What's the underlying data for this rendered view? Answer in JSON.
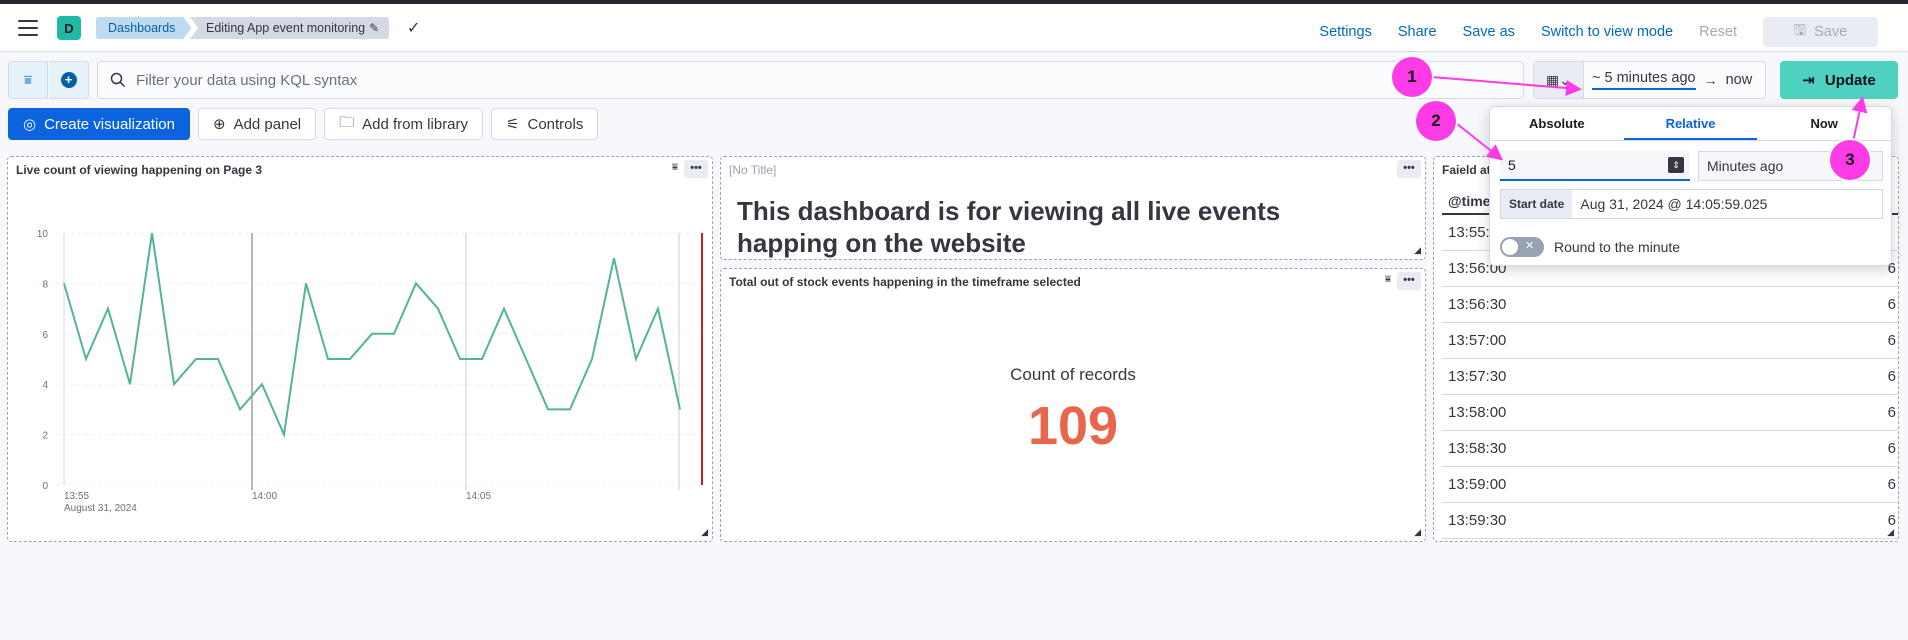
{
  "header": {
    "app_initial": "D",
    "breadcrumbs": [
      "Dashboards",
      "Editing App event monitoring"
    ],
    "links": [
      "Settings",
      "Share",
      "Save as",
      "Switch to view mode",
      "Reset"
    ],
    "save_label": "Save"
  },
  "querybar": {
    "kql_placeholder": "Filter your data using KQL syntax",
    "start": "~ 5 minutes ago",
    "end": "now",
    "update_label": "Update"
  },
  "toolbar": {
    "create_visualization": "Create visualization",
    "add_panel": "Add panel",
    "add_from_library": "Add from library",
    "controls": "Controls"
  },
  "panels": {
    "line_title": "Live count of viewing happening on Page 3",
    "note_title": "[No Title]",
    "note_text": "This dashboard is for viewing all live events happing on the website",
    "metric_title": "Total out of stock events happening in the timeframe selected",
    "metric_label": "Count of records",
    "metric_value": "109",
    "table_title": "Faield at",
    "table_header": "@time"
  },
  "table_rows": [
    {
      "time": "13:55:",
      "value": ""
    },
    {
      "time": "13:56:00",
      "value": "6"
    },
    {
      "time": "13:56:30",
      "value": "6"
    },
    {
      "time": "13:57:00",
      "value": "6"
    },
    {
      "time": "13:57:30",
      "value": "6"
    },
    {
      "time": "13:58:00",
      "value": "6"
    },
    {
      "time": "13:58:30",
      "value": "6"
    },
    {
      "time": "13:59:00",
      "value": "6"
    },
    {
      "time": "13:59:30",
      "value": "6"
    }
  ],
  "popover": {
    "tabs": [
      "Absolute",
      "Relative",
      "Now"
    ],
    "active_tab": "Relative",
    "number_value": "5",
    "unit": "Minutes ago",
    "start_label": "Start date",
    "start_value": "Aug 31, 2024 @ 14:05:59.025",
    "round_label": "Round to the minute"
  },
  "annotations": [
    "1",
    "2",
    "3"
  ],
  "colors": {
    "accent": "#0b64dd",
    "update": "#4fd1bf",
    "line": "#54b399",
    "metric": "#e7664c",
    "annotation": "#ff3be8"
  },
  "chart_data": {
    "type": "line",
    "x": [
      "13:55",
      "",
      "",
      "",
      "",
      "",
      "",
      "",
      "",
      "",
      "",
      "",
      "",
      "",
      "",
      "",
      "",
      "",
      "",
      "",
      "",
      "",
      "",
      "",
      "",
      "",
      "",
      "",
      "",
      "",
      ""
    ],
    "xticks": [
      "13:55",
      "14:00",
      "14:05"
    ],
    "xsub": "August 31, 2024",
    "values": [
      8,
      5,
      7,
      4,
      10,
      4,
      5,
      5,
      3,
      4,
      2,
      8,
      5,
      5,
      6,
      6,
      8,
      7,
      5,
      5,
      7,
      5,
      3,
      3,
      5,
      9,
      5,
      7,
      3
    ],
    "ylim": [
      0,
      10
    ],
    "yticks": [
      0,
      2,
      4,
      6,
      8,
      10
    ]
  }
}
